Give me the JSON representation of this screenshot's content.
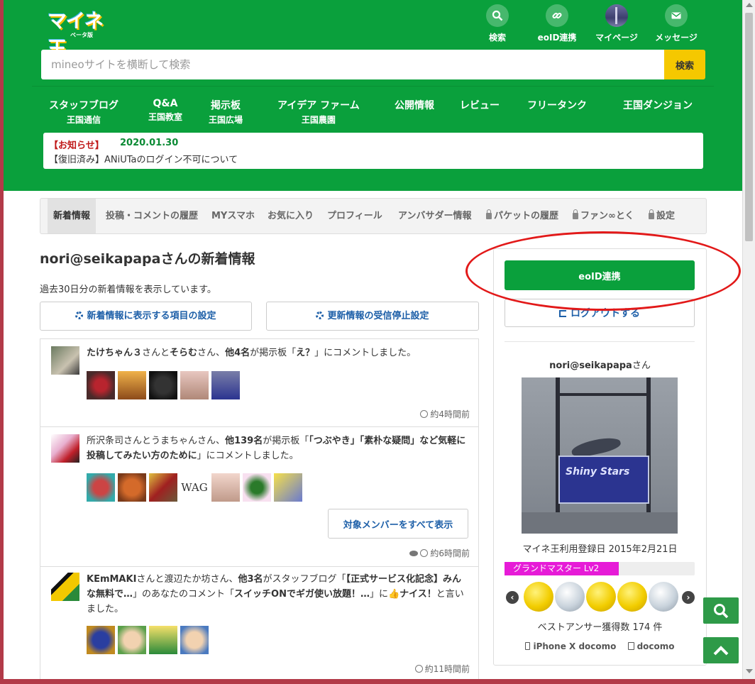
{
  "logo": {
    "text": "マイネ王",
    "sub": "ベータ版"
  },
  "header_icons": [
    {
      "label": "検索",
      "icon": "search-icon"
    },
    {
      "label": "eoID連携",
      "icon": "link-icon"
    },
    {
      "label": "マイページ",
      "icon": "avatar"
    },
    {
      "label": "メッセージ",
      "icon": "mail-icon"
    }
  ],
  "search": {
    "placeholder": "mineoサイトを横断して検索",
    "button": "検索"
  },
  "nav": [
    {
      "title": "スタッフブログ",
      "sub": "王国通信"
    },
    {
      "title": "Q&A",
      "sub": "王国教室"
    },
    {
      "title": "掲示板",
      "sub": "王国広場"
    },
    {
      "title": "アイデア ファーム",
      "sub": "王国農園"
    },
    {
      "title": "公開情報",
      "sub": ""
    },
    {
      "title": "レビュー",
      "sub": ""
    },
    {
      "title": "フリータンク",
      "sub": ""
    },
    {
      "title": "王国ダンジョン",
      "sub": ""
    }
  ],
  "notice": {
    "tag": "【お知らせ】",
    "date": "2020.01.30",
    "text": "【復旧済み】ANiUTaのログイン不可について"
  },
  "tabs": [
    {
      "label": "新着情報",
      "active": true,
      "locked": false
    },
    {
      "label": "投稿・コメントの履歴",
      "active": false,
      "locked": false
    },
    {
      "label": "MYスマホ",
      "active": false,
      "locked": false
    },
    {
      "label": "お気に入り",
      "active": false,
      "locked": false
    },
    {
      "label": "プロフィール",
      "active": false,
      "locked": false
    },
    {
      "label": "アンバサダー情報",
      "active": false,
      "locked": false
    },
    {
      "label": "パケットの履歴",
      "active": false,
      "locked": true
    },
    {
      "label": "ファン∞とく",
      "active": false,
      "locked": true
    },
    {
      "label": "設定",
      "active": false,
      "locked": true
    }
  ],
  "feed": {
    "title": "nori@seikapapaさんの新着情報",
    "subtitle": "過去30日分の新着情報を表示しています。",
    "settings_button": "新着情報に表示する項目の設定",
    "stop_button": "更新情報の受信停止設定",
    "items": [
      {
        "parts": [
          {
            "t": "たけちゃん３",
            "b": true
          },
          {
            "t": "さんと",
            "b": false
          },
          {
            "t": "そらむ",
            "b": true
          },
          {
            "t": "さん、",
            "b": false
          },
          {
            "t": "他4名",
            "b": true
          },
          {
            "t": "が掲示板「",
            "b": false
          },
          {
            "t": "え？",
            "b": true
          },
          {
            "t": "」にコメントしました。",
            "b": false
          }
        ],
        "time": "約4時間前"
      },
      {
        "parts": [
          {
            "t": "所沢条司",
            "b": false
          },
          {
            "t": "さんと",
            "b": false
          },
          {
            "t": "うまちゃん",
            "b": false
          },
          {
            "t": "さん、",
            "b": false
          },
          {
            "t": "他139名",
            "b": true
          },
          {
            "t": "が掲示板「",
            "b": false
          },
          {
            "t": "「つぶやき」「素朴な疑問」など気軽に投稿してみたい方のために",
            "b": true
          },
          {
            "t": "」にコメントしました。",
            "b": false
          }
        ],
        "members_button": "対象メンバーをすべて表示",
        "wag": "WAG",
        "time": "約6時間前"
      },
      {
        "parts": [
          {
            "t": "KEmMAKI",
            "b": true
          },
          {
            "t": "さんと",
            "b": false
          },
          {
            "t": "渡辺たか坊",
            "b": false
          },
          {
            "t": "さん、",
            "b": false
          },
          {
            "t": "他3名",
            "b": true
          },
          {
            "t": "がスタッフブログ「",
            "b": false
          },
          {
            "t": "【正式サービス化記念】みんな無料で…",
            "b": true
          },
          {
            "t": "」のあなたのコメント「",
            "b": false
          },
          {
            "t": "スイッチONでギガ使い放題！…",
            "b": true
          },
          {
            "t": "」に👍",
            "b": false
          },
          {
            "t": "ナイス！",
            "b": true
          },
          {
            "t": "と言いました。",
            "b": false
          }
        ],
        "time": "約11時間前"
      }
    ]
  },
  "sidebar": {
    "eoid_button": "eoID連携",
    "logout_button": "ログアウトする",
    "username": "nori@seikapapa",
    "username_suffix": "さん",
    "photo_text": "Shiny Stars",
    "registered": "マイネ王利用登録日 2015年2月21日",
    "rank": "グランドマスター Lv2",
    "rank_fraction": 0.6,
    "best_answers": "ベストアンサー獲得数 174 件",
    "device": "iPhone X docomo",
    "carrier": "docomo"
  },
  "colors": {
    "brand_green": "#0aa03c",
    "accent_yellow": "#f5c800",
    "link_blue": "#1d5fa8",
    "rank_pink": "#e61bd7",
    "annotation_red": "#e21919"
  }
}
